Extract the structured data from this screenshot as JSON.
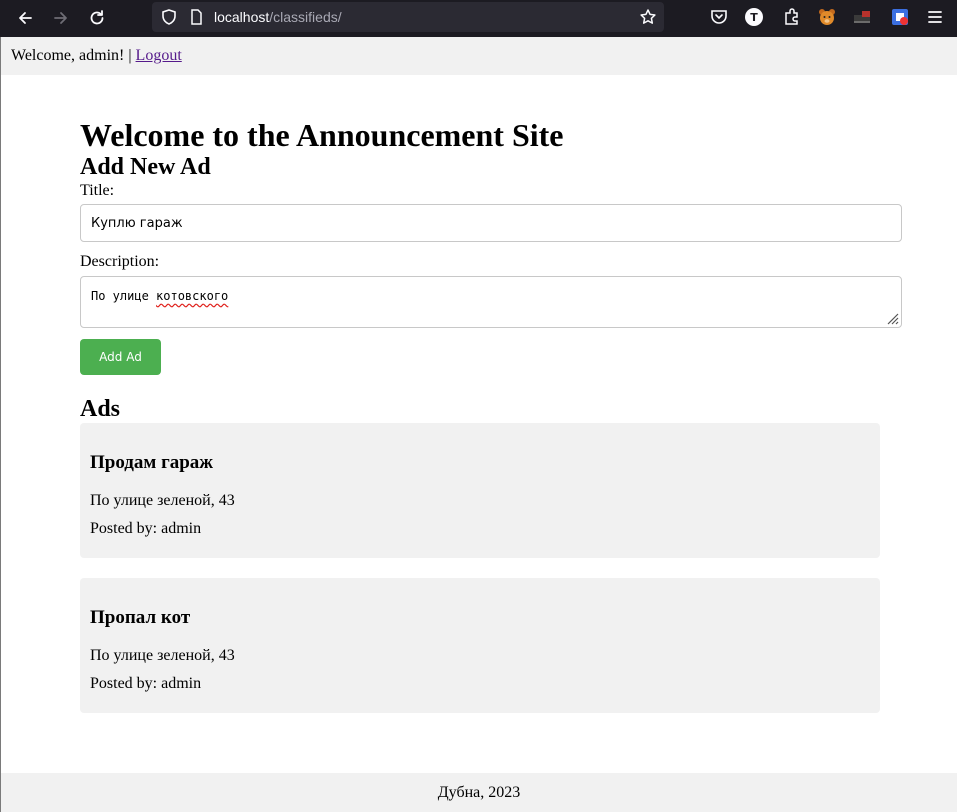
{
  "browser": {
    "url_host": "localhost",
    "url_path": "/classifieds/",
    "extension_badge": "T"
  },
  "header": {
    "welcome_text": "Welcome, admin!",
    "separator": "|",
    "logout_label": "Logout"
  },
  "page_title": "Welcome to the Announcement Site",
  "form": {
    "heading": "Add New Ad",
    "title_label": "Title:",
    "title_value": "Куплю гараж",
    "description_label": "Description:",
    "description_value_plain": "По улице ",
    "description_value_misspelled": "котовского",
    "submit_label": "Add Ad"
  },
  "ads": {
    "heading": "Ads",
    "items": [
      {
        "title": "Продам гараж",
        "description": "По улице зеленой, 43",
        "posted_by": "Posted by: admin"
      },
      {
        "title": "Пропал кот",
        "description": "По улице зеленой, 43",
        "posted_by": "Posted by: admin"
      }
    ]
  },
  "footer": {
    "text": "Дубна, 2023"
  },
  "colors": {
    "toolbar_bg": "#1c1b22",
    "urlbar_bg": "#2b2a33",
    "accent_button": "#4caf50",
    "panel_bg": "#f1f1f1",
    "link": "#551a8b"
  }
}
